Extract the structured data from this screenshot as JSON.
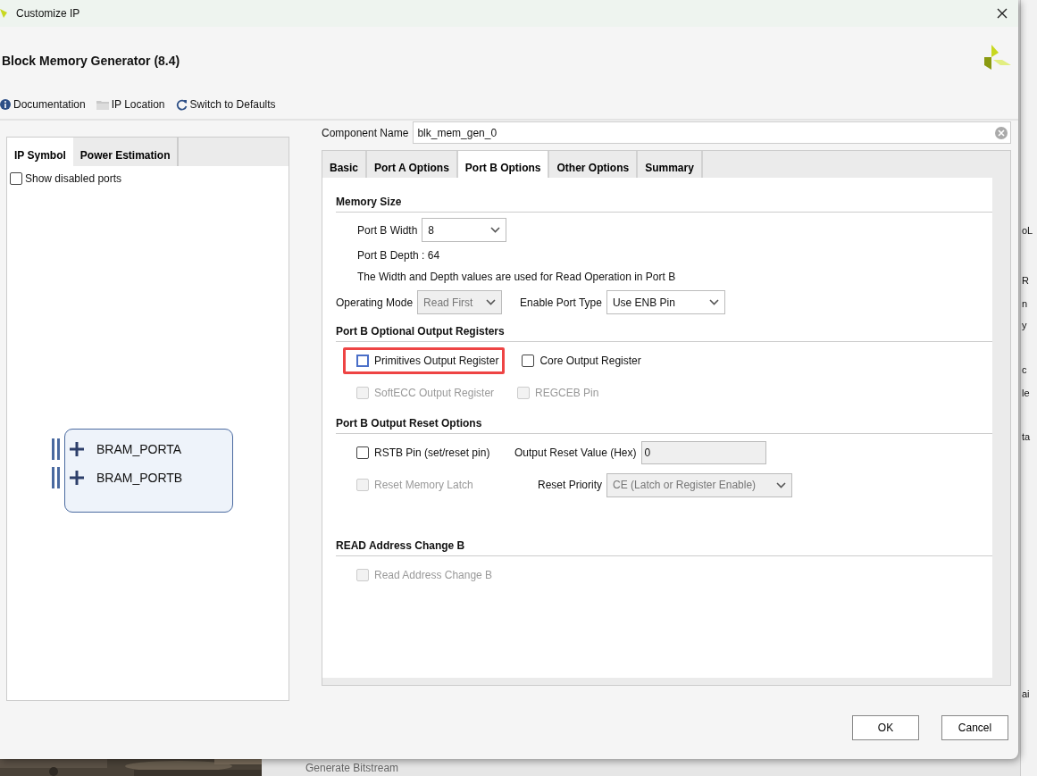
{
  "window": {
    "title": "Customize IP"
  },
  "header": {
    "title": "Block Memory Generator (8.4)",
    "toolbar": [
      {
        "kind": "info",
        "label": "Documentation"
      },
      {
        "kind": "folder",
        "label": "IP Location"
      },
      {
        "kind": "refresh",
        "label": "Switch to Defaults"
      }
    ]
  },
  "left_panel": {
    "tabs": [
      {
        "label": "IP Symbol",
        "selected": true
      },
      {
        "label": "Power Estimation",
        "selected": false
      }
    ],
    "show_disabled_ports": {
      "label": "Show disabled ports",
      "checked": false
    },
    "ports": [
      "BRAM_PORTA",
      "BRAM_PORTB"
    ]
  },
  "component_name": {
    "label": "Component Name",
    "value": "blk_mem_gen_0"
  },
  "tabs": [
    {
      "label": "Basic",
      "selected": false
    },
    {
      "label": "Port A Options",
      "selected": false
    },
    {
      "label": "Port B Options",
      "selected": true
    },
    {
      "label": "Other Options",
      "selected": false
    },
    {
      "label": "Summary",
      "selected": false
    }
  ],
  "sections": [
    {
      "title": "Memory Size",
      "rows": [
        [
          {
            "kind": "select",
            "label": "Port B Width",
            "value": "8",
            "disabled": false
          }
        ],
        [
          {
            "kind": "text",
            "text": "Port B Depth : 64"
          }
        ],
        [
          {
            "kind": "text",
            "text": "The Width and Depth values are used for Read Operation in Port B"
          }
        ],
        [
          {
            "kind": "select",
            "label": "Operating Mode",
            "value": "Read First",
            "disabled": true
          },
          {
            "kind": "select",
            "label": "Enable Port Type",
            "value": "Use ENB Pin",
            "disabled": false
          }
        ]
      ]
    },
    {
      "title": "Port B Optional Output Registers",
      "rows": [
        [
          {
            "kind": "checkbox",
            "label": "Primitives Output Register",
            "checked": false,
            "disabled": false,
            "highlighted": true
          },
          {
            "kind": "checkbox",
            "label": "Core Output Register",
            "checked": false,
            "disabled": false,
            "highlighted": false
          }
        ],
        [
          {
            "kind": "checkbox",
            "label": "SoftECC Output Register",
            "checked": false,
            "disabled": true,
            "highlighted": false
          },
          {
            "kind": "checkbox",
            "label": "REGCEB Pin",
            "checked": false,
            "disabled": true,
            "highlighted": false
          }
        ]
      ]
    },
    {
      "title": "Port B Output Reset Options",
      "rows": [
        [
          {
            "kind": "checkbox",
            "label": "RSTB Pin (set/reset pin)",
            "checked": false,
            "disabled": false,
            "highlighted": false
          },
          {
            "kind": "input",
            "label": "Output Reset Value (Hex)",
            "value": "0",
            "disabled": true
          }
        ],
        [
          {
            "kind": "checkbox",
            "label": "Reset Memory Latch",
            "checked": false,
            "disabled": true,
            "highlighted": false
          },
          {
            "kind": "select",
            "label": "Reset Priority",
            "value": "CE (Latch or Register Enable)",
            "disabled": true
          }
        ]
      ]
    },
    {
      "title": "READ Address Change B",
      "rows": [
        [
          {
            "kind": "checkbox",
            "label": "Read Address Change B",
            "checked": false,
            "disabled": true,
            "highlighted": false
          }
        ]
      ]
    }
  ],
  "buttons": [
    {
      "label": "OK"
    },
    {
      "label": "Cancel"
    }
  ],
  "background": {
    "task": "Generate Bitstream",
    "fragments": [
      "oL",
      "R",
      "n",
      "y",
      "c",
      "le",
      "ta",
      "ai"
    ]
  }
}
